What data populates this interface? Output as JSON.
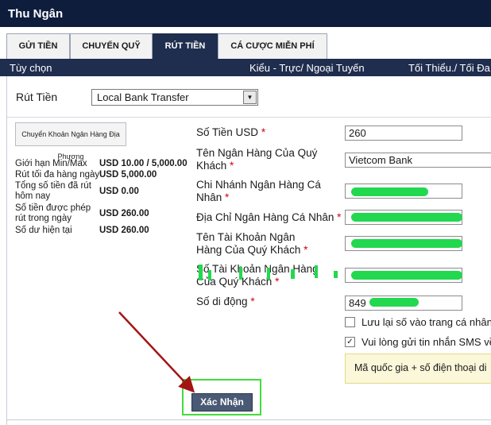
{
  "app": {
    "title": "Thu Ngân"
  },
  "tabs": [
    {
      "label": "GỬI TIỀN",
      "active": false
    },
    {
      "label": "CHUYỂN QUỸ",
      "active": false
    },
    {
      "label": "RÚT TIỀN",
      "active": true
    },
    {
      "label": "CÁ CƯỢC MIỄN PHÍ",
      "active": false
    }
  ],
  "subheader": {
    "options": "Tùy chọn",
    "type": "Kiểu - Trực/ Ngoại Tuyến",
    "minmax": "Tối Thiểu./ Tối Đa."
  },
  "withdraw": {
    "label": "Rút Tiền",
    "method_selected": "Local Bank Transfer"
  },
  "method_button": "Chuyển Khoản Ngân Hàng Địa Phương",
  "limits": [
    {
      "label": "Giới hạn Min/Max",
      "value": "USD 10.00 / 5,000.00"
    },
    {
      "label": "Rút tối đa hàng ngày",
      "value": "USD 5,000.00"
    },
    {
      "label": "Tổng số tiền đã rút hôm nay",
      "value": "USD 0.00"
    },
    {
      "label": "Số tiền được phép rút trong ngày",
      "value": "USD 260.00"
    },
    {
      "label": "Số dư hiện tại",
      "value": "USD 260.00"
    }
  ],
  "form": {
    "amount": {
      "label": "Số Tiền USD",
      "value": "260"
    },
    "bank_name": {
      "label": "Tên Ngân Hàng Của Quý Khách",
      "value": "Vietcom Bank"
    },
    "branch": {
      "label": "Chi Nhánh Ngân Hàng Cá Nhân"
    },
    "bank_address": {
      "label": "Địa Chỉ Ngân Hàng Cá Nhân"
    },
    "account_name": {
      "label": "Tên Tài Khoản Ngân Hàng Của Quý Khách"
    },
    "account_number": {
      "label": "Số Tài Khoản Ngân Hàng Của Quý Khách"
    },
    "mobile": {
      "label": "Số di động",
      "value": "849"
    }
  },
  "checkboxes": {
    "save_number": {
      "label": "Lưu lại số vào trang cá nhân?",
      "checked": false
    },
    "sms": {
      "label": "Vui lòng gửi tin nhắn SMS về",
      "checked": true
    }
  },
  "note": "Mã quốc gia + số điện thoại di",
  "confirm_label": "Xác Nhận",
  "required_mark": "*",
  "colors": {
    "header": "#0f1d3d",
    "subheader": "#1f2d4e",
    "highlight": "#44dc3a",
    "arrow": "#a31515",
    "required": "#d0021b"
  }
}
